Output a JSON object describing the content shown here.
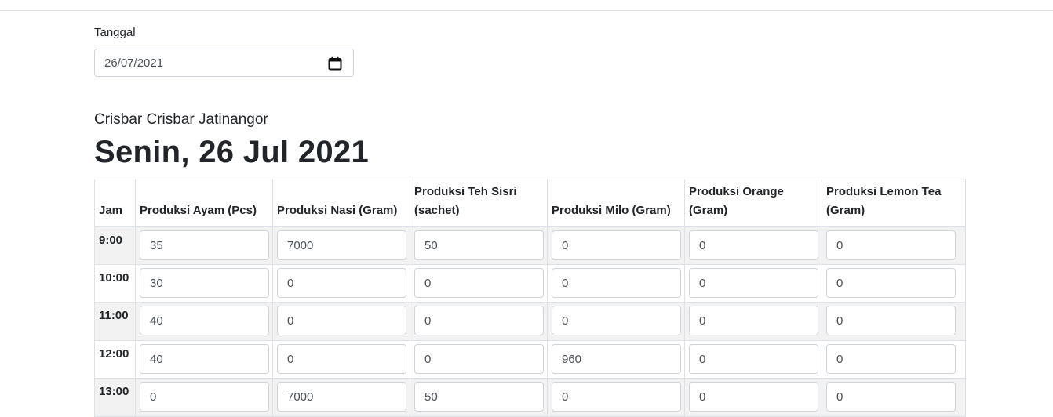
{
  "filter": {
    "date_label": "Tanggal",
    "date_value": "26/07/2021"
  },
  "store_name": "Crisbar Crisbar Jatinangor",
  "page_title": "Senin, 26 Jul 2021",
  "table": {
    "headers": [
      "Jam",
      "Produksi Ayam (Pcs)",
      "Produksi Nasi (Gram)",
      "Produksi Teh Sisri (sachet)",
      "Produksi Milo (Gram)",
      "Produksi Orange (Gram)",
      "Produksi Lemon Tea (Gram)"
    ],
    "rows": [
      {
        "hour": "9:00",
        "values": [
          "35",
          "7000",
          "50",
          "0",
          "0",
          "0"
        ]
      },
      {
        "hour": "10:00",
        "values": [
          "30",
          "0",
          "0",
          "0",
          "0",
          "0"
        ]
      },
      {
        "hour": "11:00",
        "values": [
          "40",
          "0",
          "0",
          "0",
          "0",
          "0"
        ]
      },
      {
        "hour": "12:00",
        "values": [
          "40",
          "0",
          "0",
          "960",
          "0",
          "0"
        ]
      },
      {
        "hour": "13:00",
        "values": [
          "0",
          "7000",
          "50",
          "0",
          "0",
          "0"
        ]
      }
    ]
  },
  "icons": {
    "calendar": "calendar-icon"
  }
}
